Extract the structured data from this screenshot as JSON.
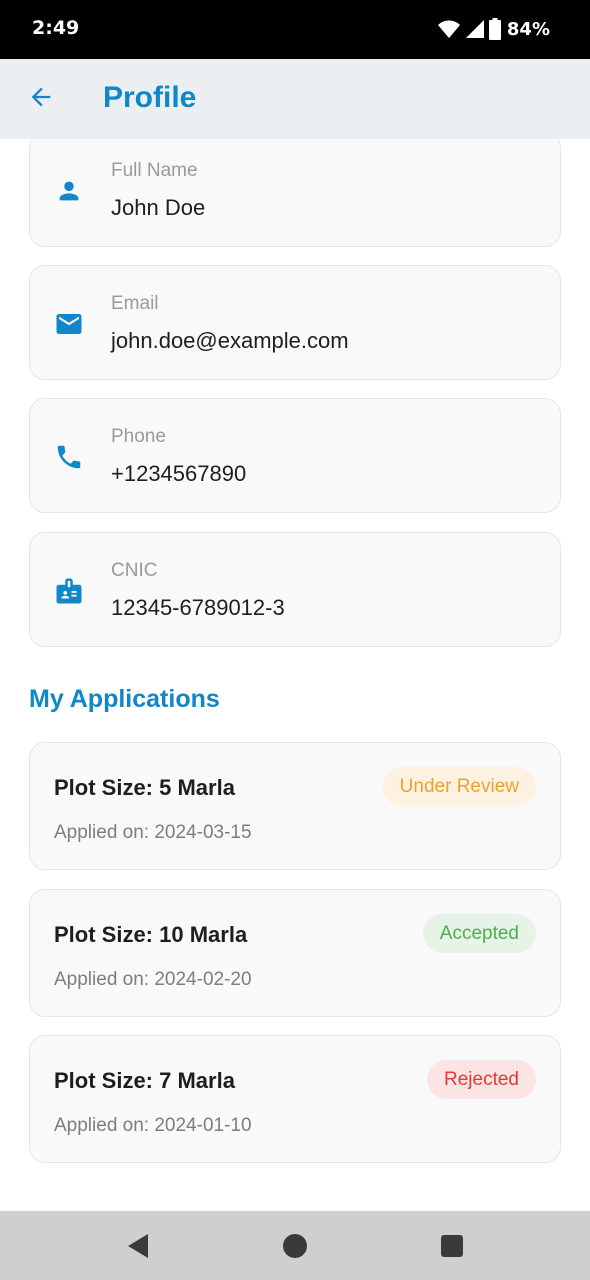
{
  "status_bar": {
    "time": "2:49",
    "battery": "84%",
    "icons": [
      "wifi-icon",
      "signal-icon",
      "battery-icon"
    ]
  },
  "app_bar": {
    "title": "Profile",
    "back_icon": "arrow-left-icon"
  },
  "profile": {
    "fields": [
      {
        "label": "Full Name",
        "value": "John Doe",
        "icon": "person-icon"
      },
      {
        "label": "Email",
        "value": "john.doe@example.com",
        "icon": "mail-icon"
      },
      {
        "label": "Phone",
        "value": "+1234567890",
        "icon": "phone-icon"
      },
      {
        "label": "CNIC",
        "value": "12345-6789012-3",
        "icon": "id-badge-icon"
      }
    ]
  },
  "applications": {
    "title": "My Applications",
    "items": [
      {
        "plot": "Plot Size: 5 Marla",
        "date": "Applied on: 2024-03-15",
        "status": "Under Review"
      },
      {
        "plot": "Plot Size: 10 Marla",
        "date": "Applied on: 2024-02-20",
        "status": "Accepted"
      },
      {
        "plot": "Plot Size: 7 Marla",
        "date": "Applied on: 2024-01-10",
        "status": "Rejected"
      }
    ]
  },
  "colors": {
    "primary": "#0f87c8",
    "under_review_text": "#f0a030",
    "under_review_bg": "#fdf1e1",
    "accepted_text": "#4caf50",
    "accepted_bg": "#e6f3e6",
    "rejected_text": "#e53935",
    "rejected_bg": "#fbe4e4"
  },
  "nav_bar": {
    "icons": [
      "back-triangle-icon",
      "home-circle-icon",
      "recents-square-icon"
    ]
  }
}
